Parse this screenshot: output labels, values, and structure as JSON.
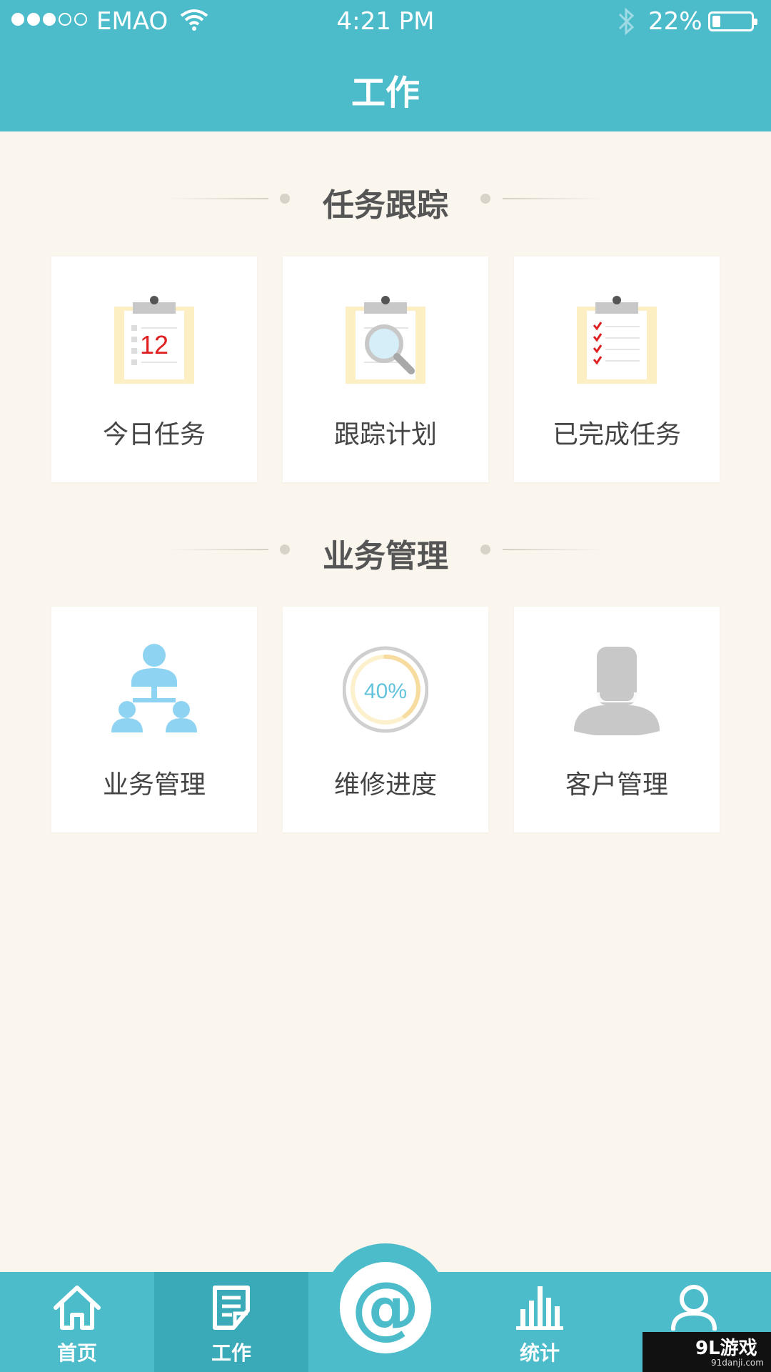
{
  "status_bar": {
    "carrier": "EMAO",
    "time": "4:21 PM",
    "battery_percent": "22%",
    "battery_level": 0.22
  },
  "nav": {
    "title": "工作"
  },
  "sections": [
    {
      "title": "任务跟踪",
      "cards": [
        {
          "label": "今日任务",
          "icon": "calendar-clipboard-icon",
          "icon_text": "12"
        },
        {
          "label": "跟踪计划",
          "icon": "search-clipboard-icon"
        },
        {
          "label": "已完成任务",
          "icon": "checklist-clipboard-icon"
        }
      ]
    },
    {
      "title": "业务管理",
      "cards": [
        {
          "label": "业务管理",
          "icon": "org-chart-icon"
        },
        {
          "label": "维修进度",
          "icon": "progress-ring-icon",
          "icon_text": "40%",
          "progress": 0.4
        },
        {
          "label": "客户管理",
          "icon": "customer-avatar-icon"
        }
      ]
    }
  ],
  "tab_bar": {
    "items": [
      {
        "label": "首页",
        "icon": "home-icon",
        "active": false
      },
      {
        "label": "工作",
        "icon": "document-edit-icon",
        "active": true
      },
      {
        "label": "",
        "icon": "at-icon",
        "center_glyph": "@"
      },
      {
        "label": "统计",
        "icon": "bar-chart-icon",
        "active": false
      },
      {
        "label": "",
        "icon": "user-icon",
        "active": false
      }
    ]
  },
  "watermark": {
    "main": "9L游戏",
    "sub": "91danji.com"
  },
  "colors": {
    "primary": "#4cbccb",
    "primary_dark": "#3aa9b8",
    "background": "#faf6ee",
    "card": "#ffffff",
    "accent_red": "#e02020",
    "icon_blue": "#8fd3f2",
    "icon_grey": "#c8c8c8",
    "clipboard_yellow": "#fdefc4"
  }
}
